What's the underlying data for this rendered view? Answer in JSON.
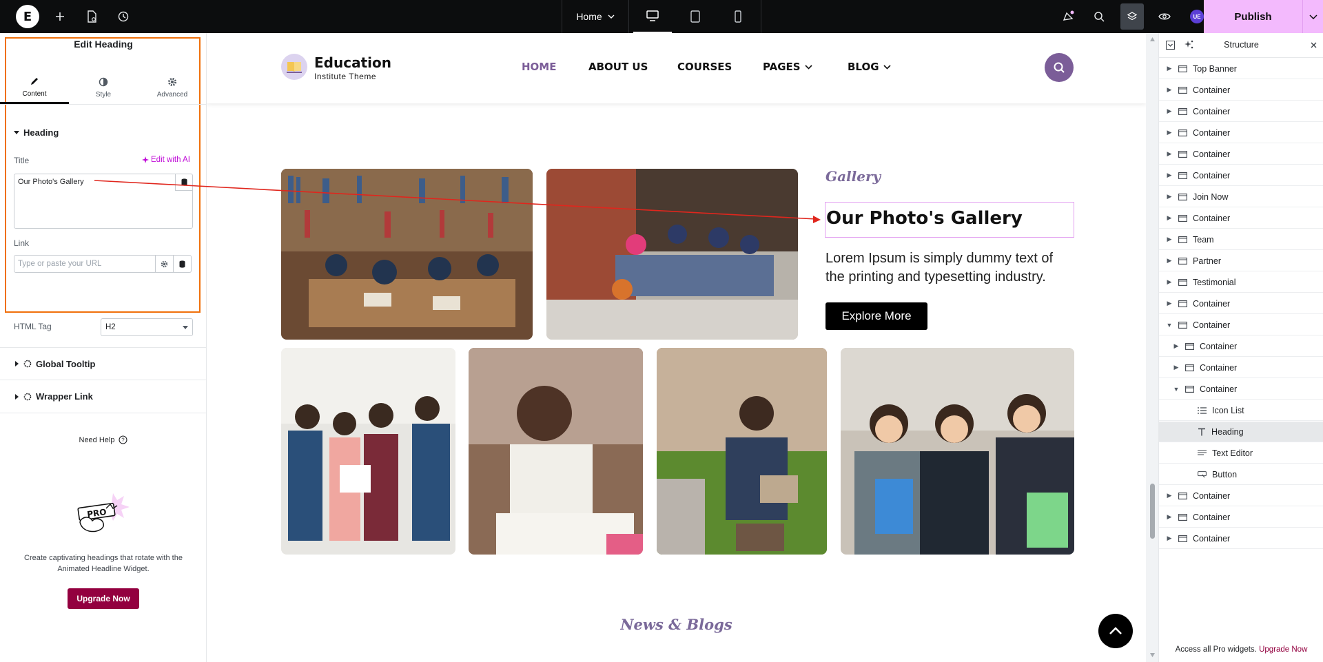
{
  "topbar": {
    "page_name": "Home",
    "publish_label": "Publish",
    "avatar_initials": "UE"
  },
  "panel": {
    "title": "Edit Heading",
    "tabs": [
      {
        "label": "Content",
        "icon": "pencil-icon"
      },
      {
        "label": "Style",
        "icon": "contrast-icon"
      },
      {
        "label": "Advanced",
        "icon": "gear-icon"
      }
    ],
    "section_heading": "Heading",
    "title_label": "Title",
    "edit_ai_label": "Edit with AI",
    "title_value": "Our Photo's Gallery",
    "link_label": "Link",
    "link_placeholder": "Type or paste your URL",
    "html_tag_label": "HTML Tag",
    "html_tag_value": "H2",
    "global_tooltip": "Global Tooltip",
    "wrapper_link": "Wrapper Link",
    "need_help": "Need Help",
    "promo_badge": "PRO",
    "promo_text": "Create captivating headings that rotate with the Animated Headline Widget.",
    "upgrade_label": "Upgrade Now"
  },
  "site": {
    "name": "Education",
    "tagline": "Institute Theme",
    "nav": [
      {
        "label": "HOME",
        "active": true,
        "dropdown": false
      },
      {
        "label": "ABOUT US",
        "active": false,
        "dropdown": false
      },
      {
        "label": "COURSES",
        "active": false,
        "dropdown": false
      },
      {
        "label": "PAGES",
        "active": false,
        "dropdown": true
      },
      {
        "label": "BLOG",
        "active": false,
        "dropdown": true
      }
    ],
    "gallery_subtitle": "Gallery",
    "gallery_heading": "Our Photo's Gallery",
    "gallery_text": "Lorem Ipsum is simply dummy text of the printing and typesetting industry.",
    "explore_label": "Explore More",
    "news_heading": "News & Blogs"
  },
  "structure": {
    "title": "Structure",
    "items": [
      {
        "label": "Top Banner",
        "level": 0,
        "arrow": "right"
      },
      {
        "label": "Container",
        "level": 0,
        "arrow": "right"
      },
      {
        "label": "Container",
        "level": 0,
        "arrow": "right"
      },
      {
        "label": "Container",
        "level": 0,
        "arrow": "right"
      },
      {
        "label": "Container",
        "level": 0,
        "arrow": "right"
      },
      {
        "label": "Container",
        "level": 0,
        "arrow": "right"
      },
      {
        "label": "Join Now",
        "level": 0,
        "arrow": "right"
      },
      {
        "label": "Container",
        "level": 0,
        "arrow": "right"
      },
      {
        "label": "Team",
        "level": 0,
        "arrow": "right"
      },
      {
        "label": "Partner",
        "level": 0,
        "arrow": "right"
      },
      {
        "label": "Testimonial",
        "level": 0,
        "arrow": "right"
      },
      {
        "label": "Container",
        "level": 0,
        "arrow": "right"
      },
      {
        "label": "Container",
        "level": 0,
        "arrow": "down"
      },
      {
        "label": "Container",
        "level": 1,
        "arrow": "right"
      },
      {
        "label": "Container",
        "level": 1,
        "arrow": "right"
      },
      {
        "label": "Container",
        "level": 1,
        "arrow": "down"
      },
      {
        "label": "Icon List",
        "level": 2,
        "arrow": "none",
        "icon": "list-icon"
      },
      {
        "label": "Heading",
        "level": 2,
        "arrow": "none",
        "icon": "heading-icon",
        "selected": true
      },
      {
        "label": "Text Editor",
        "level": 2,
        "arrow": "none",
        "icon": "text-icon"
      },
      {
        "label": "Button",
        "level": 2,
        "arrow": "none",
        "icon": "button-icon"
      },
      {
        "label": "Container",
        "level": 0,
        "arrow": "right"
      },
      {
        "label": "Container",
        "level": 0,
        "arrow": "right"
      },
      {
        "label": "Container",
        "level": 0,
        "arrow": "right"
      }
    ],
    "footer_text": "Access all Pro widgets.",
    "footer_link": "Upgrade Now"
  },
  "colors": {
    "accent_pink": "#f3bafd",
    "brand_purple": "#7b5d98",
    "selection_orange": "#f0700a",
    "annotation_red": "#e0261d",
    "upgrade_red": "#93003f"
  }
}
